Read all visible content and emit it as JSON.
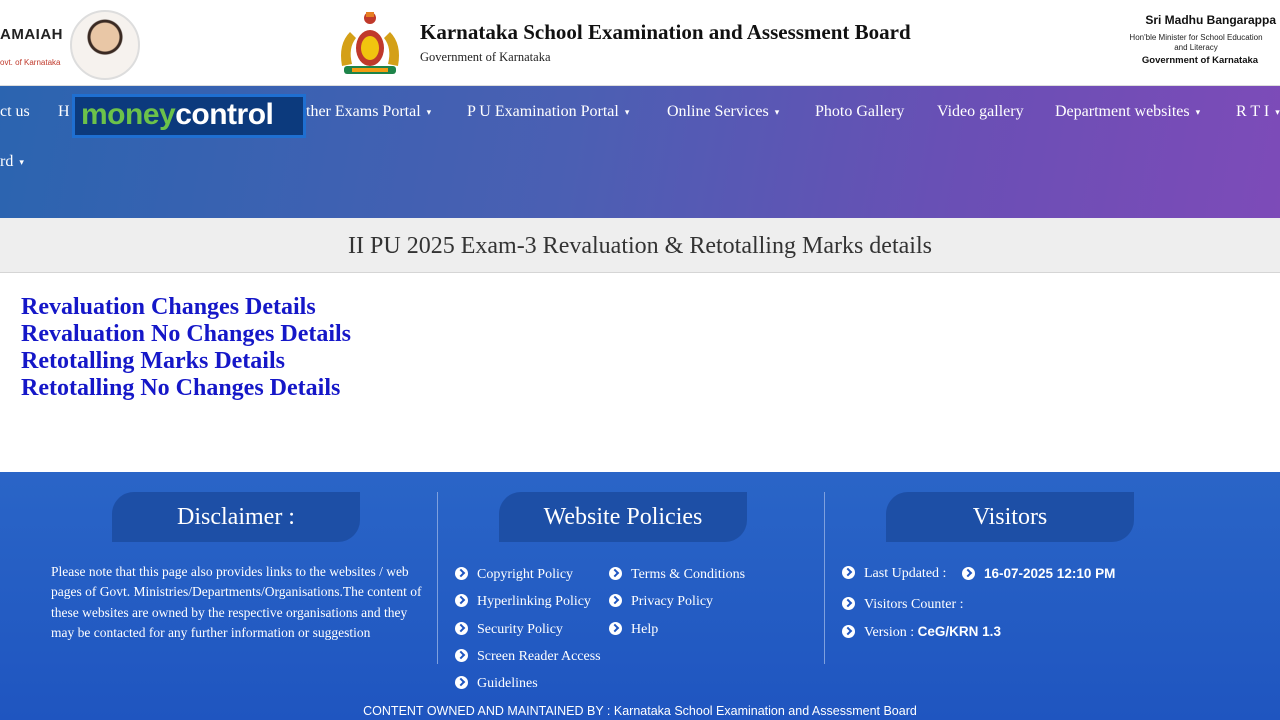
{
  "header": {
    "cm_name_partial": "AMAIAH",
    "cm_subtitle_partial": "ovt. of Karnataka",
    "board_title": "Karnataka School Examination and Assessment Board",
    "board_subtitle": "Government of Karnataka",
    "minister_name": "Sri Madhu Bangarappa",
    "minister_role": "Hon'ble Minister for School Education\nand Literacy",
    "minister_gov": "Government of Karnataka"
  },
  "nav": {
    "items": [
      {
        "label": "ct us",
        "dropdown": false
      },
      {
        "label": "H",
        "dropdown": false
      },
      {
        "label": "ther Exams Portal",
        "dropdown": true
      },
      {
        "label": "P U Examination Portal",
        "dropdown": true
      },
      {
        "label": "Online Services",
        "dropdown": true
      },
      {
        "label": "Photo Gallery",
        "dropdown": false
      },
      {
        "label": "Video gallery",
        "dropdown": false
      },
      {
        "label": "Department websites",
        "dropdown": true
      },
      {
        "label": "R T I",
        "dropdown": true
      },
      {
        "label": "rd",
        "dropdown": true
      }
    ],
    "caret": "▾"
  },
  "watermark": {
    "part1": "money",
    "part2": "control"
  },
  "page_title": "II PU 2025 Exam-3 Revaluation & Retotalling Marks details",
  "links": [
    "Revaluation Changes Details",
    "Revaluation No Changes Details",
    "Retotalling Marks Details",
    "Retotalling No Changes Details"
  ],
  "footer": {
    "disclaimer_title": "Disclaimer :",
    "disclaimer_text": "Please note that this page also provides links to the websites / web pages of Govt. Ministries/Departments/Organisations.The content of these websites are owned by the respective organisations and they may be contacted for any further information or suggestion",
    "policies_title": "Website Policies",
    "policies_col1": [
      "Copyright Policy",
      "Hyperlinking Policy",
      "Security Policy",
      "Screen Reader Access",
      "Guidelines"
    ],
    "policies_col2": [
      "Terms & Conditions",
      "Privacy Policy",
      "Help"
    ],
    "visitors_title": "Visitors",
    "last_updated_label": "Last Updated :",
    "last_updated_value": "16-07-2025 12:10 PM",
    "visitors_counter_label": "Visitors Counter :",
    "version_label": "Version :",
    "version_value": "CeG/KRN 1.3",
    "bottom_text": "CONTENT OWNED AND MAINTAINED BY : Karnataka School Examination and Assessment Board"
  },
  "colors": {
    "link": "#1517c8",
    "footer_bg": "#1f55c0",
    "tab_bg": "#1d4fa6",
    "nav_start": "#2b64b0",
    "nav_end": "#7d4bb8"
  }
}
